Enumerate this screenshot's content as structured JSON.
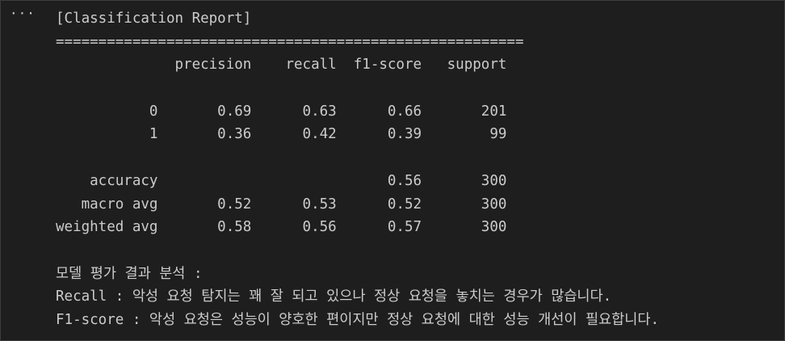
{
  "cell": {
    "more_actions_label": "···"
  },
  "output": {
    "lines": [
      "[Classification Report]",
      "=======================================================",
      "              precision    recall  f1-score   support",
      "",
      "           0       0.69      0.63      0.66       201",
      "           1       0.36      0.42      0.39        99",
      "",
      "    accuracy                           0.56       300",
      "   macro avg       0.52      0.53      0.52       300",
      "weighted avg       0.58      0.56      0.57       300",
      "",
      "모델 평가 결과 분석 :",
      "Recall : 악성 요청 탐지는 꽤 잘 되고 있으나 정상 요청을 놓치는 경우가 많습니다.",
      "F1-score : 악성 요청은 성능이 양호한 편이지만 정상 요청에 대한 성능 개선이 필요합니다."
    ]
  }
}
